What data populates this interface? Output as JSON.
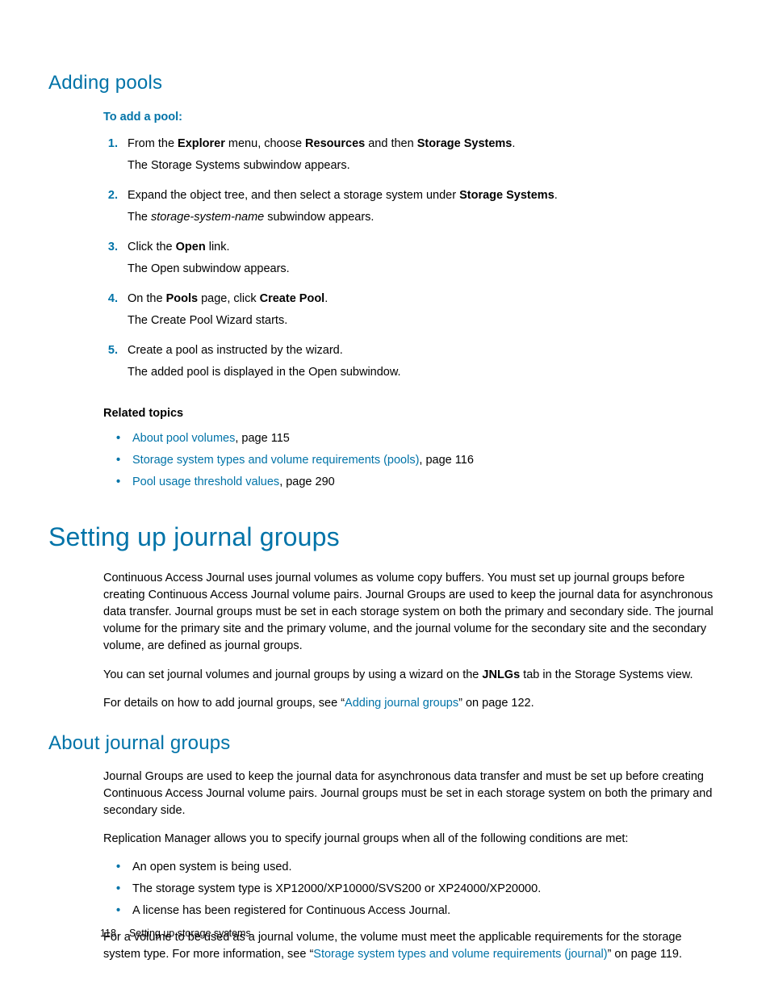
{
  "section1": {
    "heading": "Adding pools",
    "leadIn": "To add a pool:",
    "steps": [
      {
        "num": "1.",
        "l1_pre": "From the ",
        "l1_b1": "Explorer",
        "l1_mid1": " menu, choose ",
        "l1_b2": "Resources",
        "l1_mid2": " and then ",
        "l1_b3": "Storage Systems",
        "l1_post": ".",
        "l2": "The Storage Systems subwindow appears."
      },
      {
        "num": "2.",
        "l1_pre": "Expand the object tree, and then select a storage system under ",
        "l1_b1": "Storage Systems",
        "l1_post": ".",
        "l2_pre": "The ",
        "l2_i": "storage-system-name",
        "l2_post": " subwindow appears."
      },
      {
        "num": "3.",
        "l1_pre": "Click the ",
        "l1_b1": "Open",
        "l1_post": " link.",
        "l2": "The Open subwindow appears."
      },
      {
        "num": "4.",
        "l1_pre": "On the ",
        "l1_b1": "Pools",
        "l1_mid1": " page, click ",
        "l1_b2": "Create Pool",
        "l1_post": ".",
        "l2": "The Create Pool Wizard starts."
      },
      {
        "num": "5.",
        "l1": "Create a pool as instructed by the wizard.",
        "l2": "The added pool is displayed in the Open subwindow."
      }
    ],
    "related": {
      "heading": "Related topics",
      "items": [
        {
          "link": "About pool volumes",
          "page": ", page 115"
        },
        {
          "link": "Storage system types and volume requirements (pools)",
          "page": ", page 116"
        },
        {
          "link": "Pool usage threshold values",
          "page": ", page 290"
        }
      ]
    }
  },
  "section2": {
    "heading": "Setting up journal groups",
    "p1": "Continuous Access Journal uses journal volumes as volume copy buffers. You must set up journal groups before creating Continuous Access Journal volume pairs. Journal Groups are used to keep the journal data for asynchronous data transfer. Journal groups must be set in each storage system on both the primary and secondary side. The journal volume for the primary site and the primary volume, and the journal volume for the secondary site and the secondary volume, are defined as journal groups.",
    "p2_pre": "You can set journal volumes and journal groups by using a wizard on the ",
    "p2_b": "JNLGs",
    "p2_post": " tab in the Storage Systems view.",
    "p3_pre": " For details on how to add journal groups, see “",
    "p3_link": "Adding journal groups",
    "p3_post": "” on page 122."
  },
  "section3": {
    "heading": "About journal groups",
    "p1": "Journal Groups are used to keep the journal data for asynchronous data transfer and must be set up before creating Continuous Access Journal volume pairs. Journal groups must be set in each storage system on both the primary and secondary side.",
    "p2": "Replication Manager allows you to specify journal groups when all of the following conditions are met:",
    "bullets": [
      "An open system is being used.",
      "The storage system type is XP12000/XP10000/SVS200 or XP24000/XP20000.",
      "A license has been registered for Continuous Access Journal."
    ],
    "p3_pre": "For a volume to be used as a journal volume, the volume must meet the applicable requirements for the storage system type. For more information, see “",
    "p3_link": "Storage system types and volume requirements (journal)",
    "p3_post": "” on page 119."
  },
  "footer": {
    "pageNum": "118",
    "chapter": "Setting up storage systems"
  }
}
